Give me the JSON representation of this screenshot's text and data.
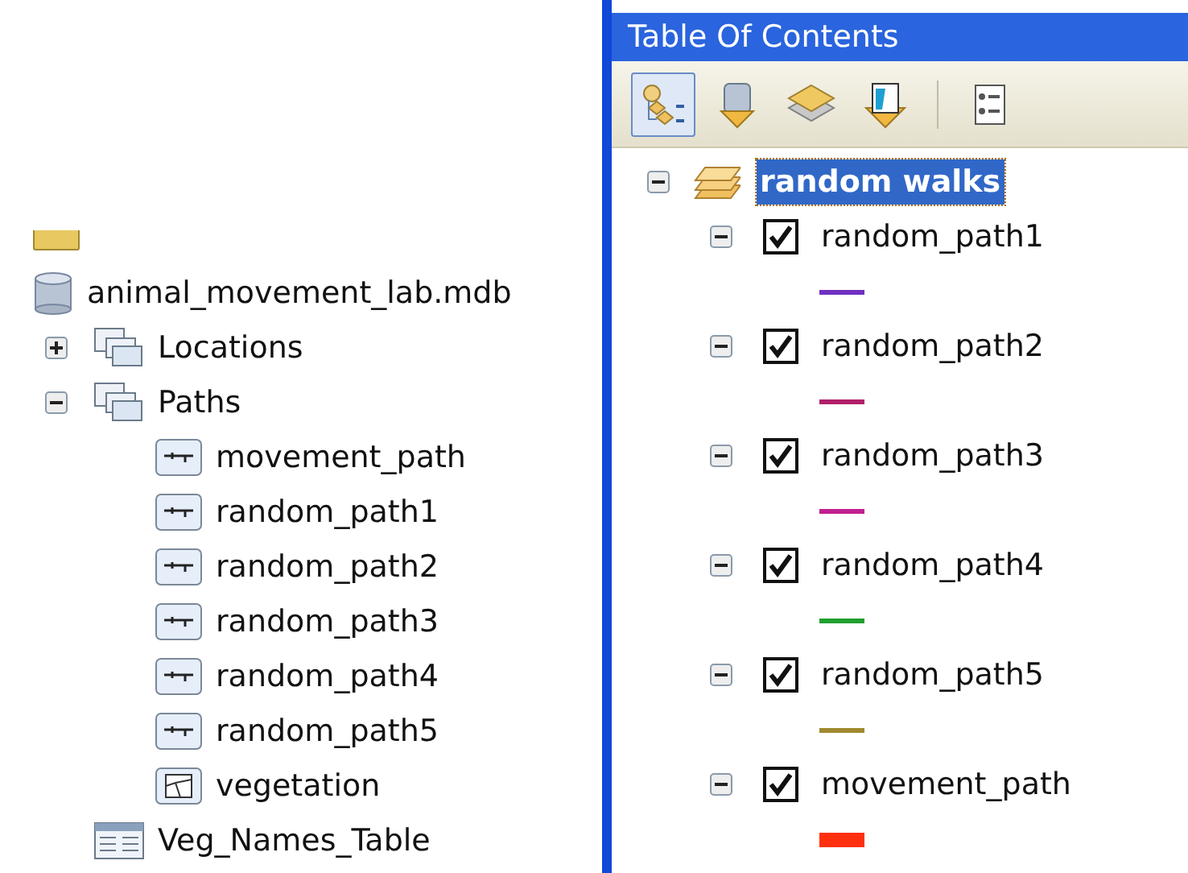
{
  "catalog_tree": [
    {
      "kind": "folder"
    },
    {
      "kind": "database",
      "label": "animal_movement_lab.mdb",
      "children": [
        {
          "kind": "dataset",
          "label": "Locations",
          "expanded": false
        },
        {
          "kind": "dataset",
          "label": "Paths",
          "expanded": true,
          "children": [
            {
              "kind": "line_class",
              "label": "movement_path"
            },
            {
              "kind": "line_class",
              "label": "random_path1"
            },
            {
              "kind": "line_class",
              "label": "random_path2"
            },
            {
              "kind": "line_class",
              "label": "random_path3"
            },
            {
              "kind": "line_class",
              "label": "random_path4"
            },
            {
              "kind": "line_class",
              "label": "random_path5"
            },
            {
              "kind": "raster",
              "label": "vegetation"
            }
          ]
        },
        {
          "kind": "table",
          "label": "Veg_Names_Table"
        }
      ]
    }
  ],
  "toc": {
    "title": "Table Of Contents",
    "toolbar": [
      {
        "kind": "list_by_drawing_order",
        "selected": true
      },
      {
        "kind": "list_by_source",
        "selected": false
      },
      {
        "kind": "list_by_visibility",
        "selected": false
      },
      {
        "kind": "list_by_selection",
        "selected": false
      },
      {
        "kind": "options",
        "selected": false
      }
    ],
    "group": {
      "label": "random walks",
      "selected": true,
      "expanded": true,
      "layers": [
        {
          "name": "random_path1",
          "checked": true,
          "expanded": true,
          "kind": "line",
          "color": "#7030c0"
        },
        {
          "name": "random_path2",
          "checked": true,
          "expanded": true,
          "kind": "line",
          "color": "#b0206a"
        },
        {
          "name": "random_path3",
          "checked": true,
          "expanded": true,
          "kind": "line",
          "color": "#c02090"
        },
        {
          "name": "random_path4",
          "checked": true,
          "expanded": true,
          "kind": "line",
          "color": "#20a030"
        },
        {
          "name": "random_path5",
          "checked": true,
          "expanded": true,
          "kind": "line",
          "color": "#a08a30"
        },
        {
          "name": "movement_path",
          "checked": true,
          "expanded": true,
          "kind": "thick_line",
          "color": "#ff3010"
        }
      ]
    }
  }
}
